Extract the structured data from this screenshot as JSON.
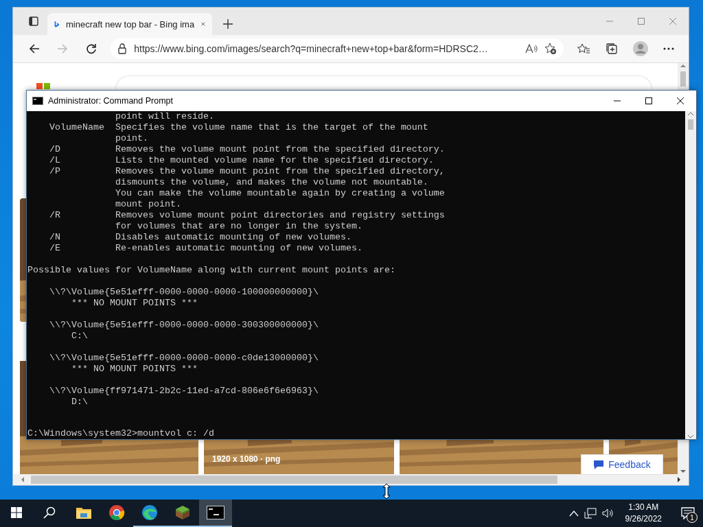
{
  "browser": {
    "tabs": [
      {
        "title": "minecraft new top bar - Bing ima",
        "selected": true
      }
    ],
    "url": "https://www.bing.com/images/search?q=minecraft+new+top+bar&form=HDRSC2…",
    "results": [
      {
        "kind": "picture"
      },
      {
        "kind": "picture",
        "caption": "1920 x 1080 · png"
      },
      {
        "kind": "picture"
      },
      {
        "kind": "picture"
      }
    ],
    "feedback": "Feedback"
  },
  "console_window": {
    "title": "Administrator: Command Prompt",
    "paragraphs": [
      [
        "                point will reside.",
        "    VolumeName  Specifies the volume name that is the target of the mount",
        "                point.",
        "    /D          Removes the volume mount point from the specified directory.",
        "    /L          Lists the mounted volume name for the specified directory.",
        "    /P          Removes the volume mount point from the specified directory,",
        "                dismounts the volume, and makes the volume not mountable.",
        "                You can make the volume mountable again by creating a volume",
        "                mount point.",
        "    /R          Removes volume mount point directories and registry settings",
        "                for volumes that are no longer in the system.",
        "    /N          Disables automatic mounting of new volumes.",
        "    /E          Re-enables automatic mounting of new volumes."
      ],
      [
        "Possible values for VolumeName along with current mount points are:"
      ],
      [
        "    \\\\?\\Volume{5e51efff-0000-0000-0000-100000000000}\\",
        "        *** NO MOUNT POINTS ***"
      ],
      [
        "    \\\\?\\Volume{5e51efff-0000-0000-0000-300300000000}\\",
        "        C:\\"
      ],
      [
        "    \\\\?\\Volume{5e51efff-0000-0000-0000-c0de13000000}\\",
        "        *** NO MOUNT POINTS ***"
      ],
      [
        "    \\\\?\\Volume{ff971471-2b2c-11ed-a7cd-806e6f6e6963}\\",
        "        D:\\"
      ]
    ],
    "prompt": "C:\\Windows\\system32>mountvol c: /d"
  },
  "taskbar": {
    "apps": [
      {
        "kind": "explorer",
        "running": false,
        "active": false
      },
      {
        "kind": "chrome",
        "running": false,
        "active": false
      },
      {
        "kind": "edge",
        "running": true,
        "active": false
      },
      {
        "kind": "minecraft",
        "running": true,
        "active": false
      },
      {
        "kind": "terminal",
        "running": true,
        "active": true
      }
    ],
    "time": "1:30 AM",
    "date": "9/26/2022",
    "notification_count": "1"
  }
}
